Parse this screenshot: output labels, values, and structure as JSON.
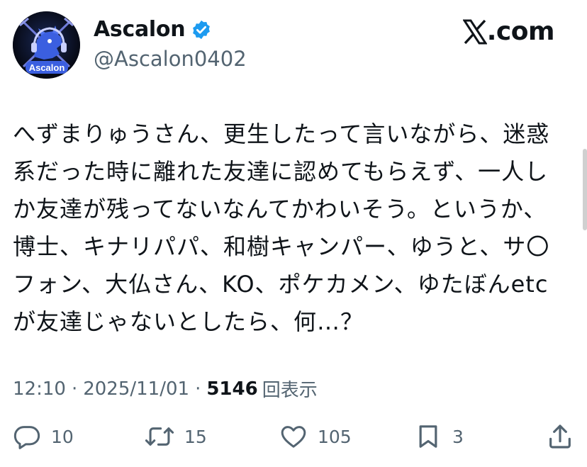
{
  "header": {
    "display_name": "Ascalon",
    "handle": "@Ascalon0402",
    "brand": "X.com",
    "brand_text": ".com",
    "avatar_label": "Ascalon",
    "verified_color": "#1d9bf0"
  },
  "tweet": {
    "lines": [
      "へずまりゅうさん、更生したって言いながら、迷惑",
      "系だった時に離れた友達に認めてもらえず、一人し",
      "か友達が残ってないなんてかわいそう。というか、",
      "博士、キナリパパ、和樹キャンパー、ゆうと、サ〇",
      "フォン、大仏さん、KO、ポケカメン、ゆたぼんetc",
      "が友達じゃないとしたら、何…？"
    ]
  },
  "meta": {
    "time": "12:10",
    "separator": "·",
    "date": "2025/11/01",
    "views_count": "5146",
    "views_label": "回表示"
  },
  "actions": {
    "reply": {
      "icon": "reply-icon",
      "count": "10"
    },
    "repost": {
      "icon": "repost-icon",
      "count": "15"
    },
    "like": {
      "icon": "heart-icon",
      "count": "105"
    },
    "bookmark": {
      "icon": "bookmark-icon",
      "count": "3"
    },
    "share": {
      "icon": "share-icon"
    }
  },
  "colors": {
    "text": "#0f1419",
    "secondary": "#536471",
    "verified": "#1d9bf0"
  }
}
